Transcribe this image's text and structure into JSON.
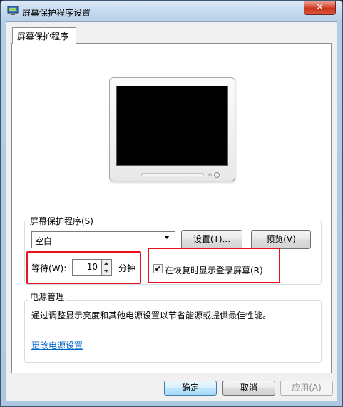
{
  "window": {
    "title": "屏幕保护程序设置",
    "close_glyph": "✕"
  },
  "tab": {
    "label": "屏幕保护程序"
  },
  "screensaver": {
    "group_label": "屏幕保护程序(S)",
    "selected": "空白",
    "settings_button": "设置(T)...",
    "preview_button": "预览(V)",
    "wait_label": "等待(W):",
    "wait_value": "10",
    "minutes_label": "分钟",
    "resume_checkbox_label": "在恢复时显示登录屏幕(R)",
    "resume_checked": true
  },
  "power": {
    "group_label": "电源管理",
    "description": "通过调整显示亮度和其他电源设置以节省能源或提供最佳性能。",
    "link": "更改电源设置"
  },
  "footer": {
    "ok": "确定",
    "cancel": "取消",
    "apply": "应用(A)"
  },
  "colors": {
    "highlight": "#e8121f",
    "link": "#0066cc",
    "default_button_border": "#3c7fb1"
  }
}
